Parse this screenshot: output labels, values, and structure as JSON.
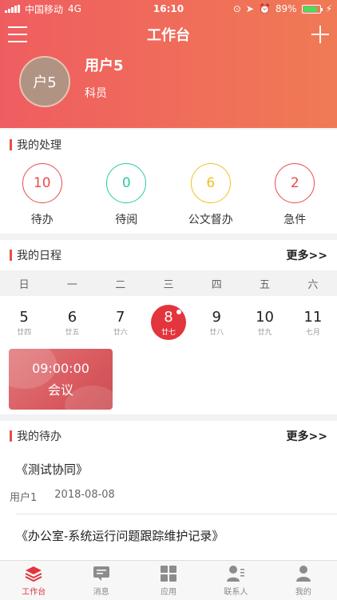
{
  "status_bar": {
    "carrier": "中国移动",
    "network": "4G",
    "time": "16:10",
    "battery": "89%"
  },
  "header": {
    "title": "工作台"
  },
  "profile": {
    "avatar_text": "户5",
    "name": "用户5",
    "role": "科员"
  },
  "processing": {
    "title": "我的处理",
    "items": [
      {
        "count": "10",
        "label": "待办",
        "color": "#e74c4c"
      },
      {
        "count": "0",
        "label": "待阅",
        "color": "#2bc9a5"
      },
      {
        "count": "6",
        "label": "公文督办",
        "color": "#f0c020"
      },
      {
        "count": "2",
        "label": "急件",
        "color": "#e74c4c"
      }
    ]
  },
  "schedule": {
    "title": "我的日程",
    "more": "更多>>",
    "weekdays": [
      "日",
      "一",
      "二",
      "三",
      "四",
      "五",
      "六"
    ],
    "days": [
      {
        "num": "5",
        "lunar": "廿四"
      },
      {
        "num": "6",
        "lunar": "廿五"
      },
      {
        "num": "7",
        "lunar": "廿六"
      },
      {
        "num": "8",
        "lunar": "廿七"
      },
      {
        "num": "9",
        "lunar": "廿八"
      },
      {
        "num": "10",
        "lunar": "廿九"
      },
      {
        "num": "11",
        "lunar": "七月"
      }
    ],
    "selected_index": 3,
    "event": {
      "time": "09:00:00",
      "title": "会议"
    }
  },
  "todos": {
    "title": "我的待办",
    "more": "更多>>",
    "items": [
      {
        "title": "《测试协同》",
        "user": "用户1",
        "date": "2018-08-08"
      },
      {
        "title": "《办公室-系统运行问题跟踪维护记录》"
      }
    ]
  },
  "tabbar": {
    "items": [
      {
        "label": "工作台",
        "icon": "layers-icon"
      },
      {
        "label": "消息",
        "icon": "message-icon"
      },
      {
        "label": "应用",
        "icon": "grid-icon"
      },
      {
        "label": "联系人",
        "icon": "contacts-icon"
      },
      {
        "label": "我的",
        "icon": "person-icon"
      }
    ],
    "active_index": 0,
    "active_color": "#e2353d"
  }
}
